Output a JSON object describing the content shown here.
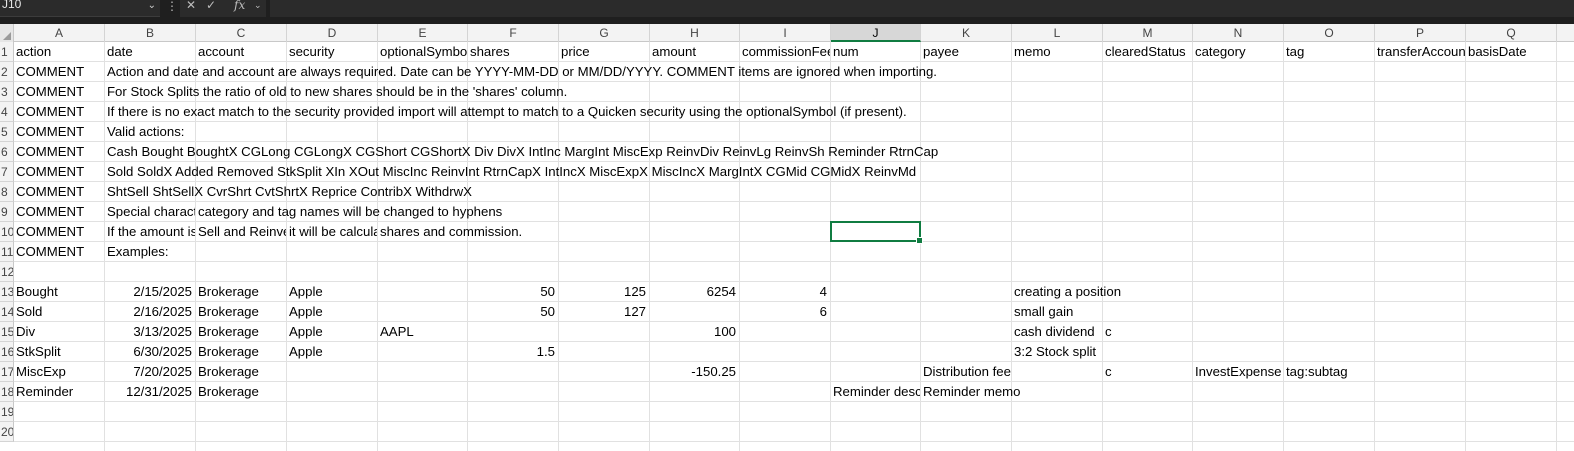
{
  "formula_bar": {
    "name_box": "J10",
    "formula": "",
    "icons": [
      "chevron-down-icon",
      "more-icon",
      "cancel-icon",
      "enter-icon",
      "function-icon"
    ]
  },
  "columns": [
    "A",
    "B",
    "C",
    "D",
    "E",
    "F",
    "G",
    "H",
    "I",
    "J",
    "K",
    "L",
    "M",
    "N",
    "O",
    "P",
    "Q"
  ],
  "active_column": "J",
  "row_numbers": [
    "1",
    "2",
    "3",
    "4",
    "5",
    "6",
    "7",
    "8",
    "9",
    "10",
    "11",
    "12",
    "13",
    "14",
    "15",
    "16",
    "17",
    "18",
    "19",
    "20"
  ],
  "selected_cell": "J10",
  "rows": [
    [
      {
        "c": "A",
        "v": "action"
      },
      {
        "c": "B",
        "v": "date"
      },
      {
        "c": "C",
        "v": "account"
      },
      {
        "c": "D",
        "v": "security"
      },
      {
        "c": "E",
        "v": "optionalSymbol"
      },
      {
        "c": "F",
        "v": "shares"
      },
      {
        "c": "G",
        "v": "price"
      },
      {
        "c": "H",
        "v": "amount"
      },
      {
        "c": "I",
        "v": "commissionFee"
      },
      {
        "c": "J",
        "v": "num"
      },
      {
        "c": "K",
        "v": "payee"
      },
      {
        "c": "L",
        "v": "memo"
      },
      {
        "c": "M",
        "v": "clearedStatus"
      },
      {
        "c": "N",
        "v": "category"
      },
      {
        "c": "O",
        "v": "tag"
      },
      {
        "c": "P",
        "v": "transferAccount"
      },
      {
        "c": "Q",
        "v": "basisDate"
      }
    ],
    [
      {
        "c": "A",
        "v": "COMMENT"
      },
      {
        "c": "B",
        "v": "Action and date and account are always required.  Date can be YYYY-MM-DD or MM/DD/YYYY.  COMMENT items are ignored when importing.",
        "ovf": true
      }
    ],
    [
      {
        "c": "A",
        "v": "COMMENT"
      },
      {
        "c": "B",
        "v": "For Stock Splits the ratio of old to new shares should be in the 'shares' column.",
        "ovf": true
      }
    ],
    [
      {
        "c": "A",
        "v": "COMMENT"
      },
      {
        "c": "B",
        "v": "If there is no exact match to the security provided import will attempt to match to a Quicken security using the optionalSymbol (if present).",
        "ovf": true
      }
    ],
    [
      {
        "c": "A",
        "v": "COMMENT"
      },
      {
        "c": "B",
        "v": "Valid actions:",
        "ovf": true
      }
    ],
    [
      {
        "c": "A",
        "v": "COMMENT"
      },
      {
        "c": "B",
        "v": "Cash Bought BoughtX CGLong CGLongX CGShort CGShortX Div DivX IntInc MargInt MiscExp ReinvDiv ReinvLg ReinvSh Reminder RtrnCap",
        "ovf": true
      }
    ],
    [
      {
        "c": "A",
        "v": "COMMENT"
      },
      {
        "c": "B",
        "v": "Sold SoldX Added Removed StkSplit XIn XOut MiscInc ReinvInt RtrnCapX IntIncX MiscExpX MiscIncX MargIntX CGMid CGMidX ReinvMd",
        "ovf": true
      }
    ],
    [
      {
        "c": "A",
        "v": "COMMENT"
      },
      {
        "c": "B",
        "v": "ShtSell ShtSellX CvrShrt CvtShrtX Reprice ContribX WithdrwX",
        "ovf": true
      }
    ],
    [
      {
        "c": "A",
        "v": "COMMENT"
      },
      {
        "c": "B",
        "v": "Special characters in category and tag names will be changed to hyphens"
      },
      {
        "c": "C",
        "v": "category and tag names will be changed to hyphens",
        "ovf": true
      }
    ],
    [
      {
        "c": "A",
        "v": "COMMENT"
      },
      {
        "c": "B",
        "v": "If the amount is missing for Buy, Sell and Reinvest actions it will be calculated from shares and commission."
      },
      {
        "c": "C",
        "v": "Sell and Reinvest"
      },
      {
        "c": "D",
        "v": "it will be calculated from"
      },
      {
        "c": "E",
        "v": "shares and commission.",
        "ovf": true
      }
    ],
    [
      {
        "c": "A",
        "v": "COMMENT"
      },
      {
        "c": "B",
        "v": "Examples:",
        "ovf": true
      }
    ],
    [],
    [
      {
        "c": "A",
        "v": "Bought"
      },
      {
        "c": "B",
        "v": "2/15/2025",
        "num": true
      },
      {
        "c": "C",
        "v": "Brokerage"
      },
      {
        "c": "D",
        "v": "Apple"
      },
      {
        "c": "F",
        "v": "50",
        "num": true
      },
      {
        "c": "G",
        "v": "125",
        "num": true
      },
      {
        "c": "H",
        "v": "6254",
        "num": true
      },
      {
        "c": "I",
        "v": "4",
        "num": true
      },
      {
        "c": "L",
        "v": "creating a position",
        "ovf": true
      }
    ],
    [
      {
        "c": "A",
        "v": "Sold"
      },
      {
        "c": "B",
        "v": "2/16/2025",
        "num": true
      },
      {
        "c": "C",
        "v": "Brokerage"
      },
      {
        "c": "D",
        "v": "Apple"
      },
      {
        "c": "F",
        "v": "50",
        "num": true
      },
      {
        "c": "G",
        "v": "127",
        "num": true
      },
      {
        "c": "I",
        "v": "6",
        "num": true
      },
      {
        "c": "L",
        "v": "small gain",
        "ovf": true
      }
    ],
    [
      {
        "c": "A",
        "v": "Div"
      },
      {
        "c": "B",
        "v": "3/13/2025",
        "num": true
      },
      {
        "c": "C",
        "v": "Brokerage"
      },
      {
        "c": "D",
        "v": "Apple"
      },
      {
        "c": "E",
        "v": "AAPL"
      },
      {
        "c": "H",
        "v": "100",
        "num": true
      },
      {
        "c": "L",
        "v": "cash dividend"
      },
      {
        "c": "M",
        "v": "c"
      }
    ],
    [
      {
        "c": "A",
        "v": "StkSplit"
      },
      {
        "c": "B",
        "v": "6/30/2025",
        "num": true
      },
      {
        "c": "C",
        "v": "Brokerage"
      },
      {
        "c": "D",
        "v": "Apple"
      },
      {
        "c": "F",
        "v": "1.5",
        "num": true
      },
      {
        "c": "L",
        "v": "3:2 Stock split",
        "ovf": true
      }
    ],
    [
      {
        "c": "A",
        "v": "MiscExp"
      },
      {
        "c": "B",
        "v": "7/20/2025",
        "num": true
      },
      {
        "c": "C",
        "v": "Brokerage"
      },
      {
        "c": "H",
        "v": "-150.25",
        "num": true
      },
      {
        "c": "K",
        "v": "Distribution fee",
        "ovf": true
      },
      {
        "c": "M",
        "v": "c"
      },
      {
        "c": "N",
        "v": "InvestExpense"
      },
      {
        "c": "O",
        "v": "tag:subtag",
        "ovf": true
      }
    ],
    [
      {
        "c": "A",
        "v": "Reminder"
      },
      {
        "c": "B",
        "v": "12/31/2025",
        "num": true
      },
      {
        "c": "C",
        "v": "Brokerage"
      },
      {
        "c": "J",
        "v": "Reminder description"
      },
      {
        "c": "K",
        "v": "Reminder memo",
        "ovf": true
      }
    ],
    [],
    []
  ]
}
